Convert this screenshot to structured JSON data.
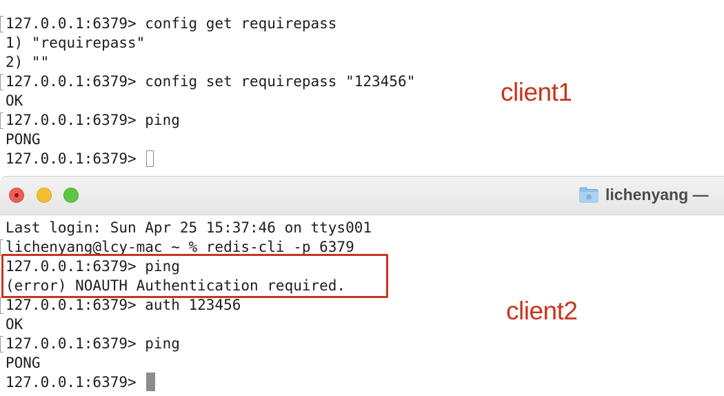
{
  "client1": {
    "label": "client1",
    "lines": [
      "127.0.0.1:6379> config get requirepass",
      "1) \"requirepass\"",
      "2) \"\"",
      "127.0.0.1:6379> config set requirepass \"123456\"",
      "OK",
      "127.0.0.1:6379> ping",
      "PONG",
      "127.0.0.1:6379> "
    ]
  },
  "window": {
    "title": "lichenyang —",
    "folder_icon": "folder-icon"
  },
  "client2": {
    "label": "client2",
    "lines": [
      "Last login: Sun Apr 25 15:37:46 on ttys001",
      "lichenyang@lcy-mac ~ % redis-cli -p 6379",
      "127.0.0.1:6379> ping",
      "(error) NOAUTH Authentication required.",
      "127.0.0.1:6379> auth 123456",
      "OK",
      "127.0.0.1:6379> ping",
      "PONG",
      "127.0.0.1:6379> "
    ]
  },
  "colors": {
    "annotation_red": "#c8341d",
    "close_button": "#ee5e56",
    "minimize_button": "#f5bd33",
    "zoom_button": "#5cc544"
  }
}
